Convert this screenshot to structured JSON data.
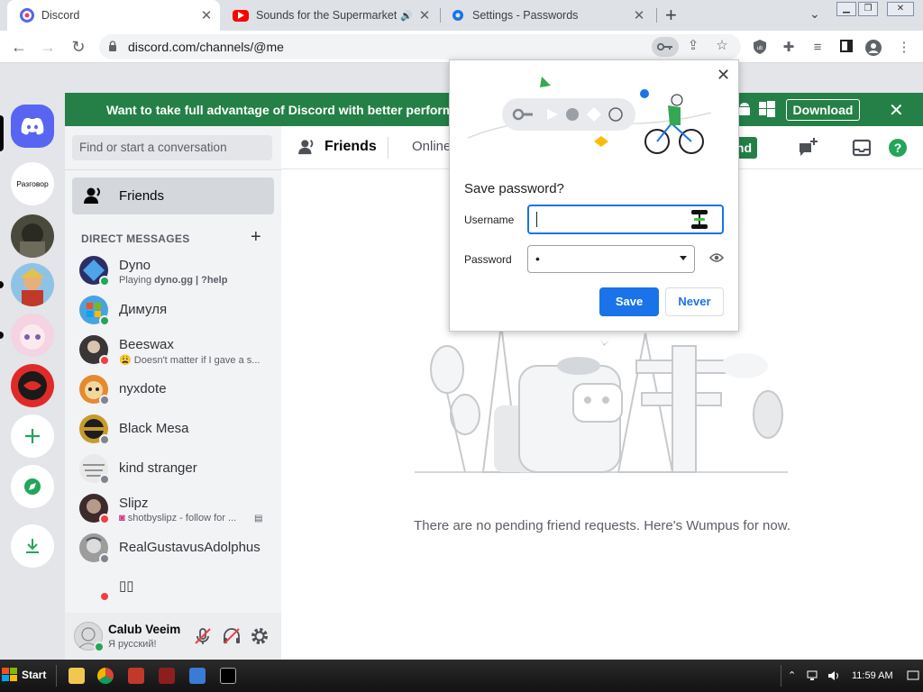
{
  "browser": {
    "tabs": [
      {
        "title": "Discord",
        "active": true
      },
      {
        "title": "Sounds for the Supermarket",
        "active": false
      },
      {
        "title": "Settings - Passwords",
        "active": false
      }
    ],
    "url": "discord.com/channels/@me"
  },
  "banner": {
    "message": "Want to take full advantage of Discord with better performance, i",
    "download_label": "Download"
  },
  "guilds": {
    "server_label": "Разговор"
  },
  "channels": {
    "search_placeholder": "Find or start a conversation",
    "friends_label": "Friends",
    "dm_header": "DIRECT MESSAGES",
    "dms": [
      {
        "name": "Dyno",
        "sub_prefix": "Playing ",
        "sub_bold": "dyno.gg | ?help",
        "status": "online",
        "color": "#2a2f66"
      },
      {
        "name": "Димуля",
        "status": "online",
        "color": "#4aa3df"
      },
      {
        "name": "Beeswax",
        "sub": "Doesn't matter if I gave a s...",
        "status": "dnd",
        "color": "#3a3536"
      },
      {
        "name": "nyxdote",
        "status": "offline",
        "color": "#e58a2e"
      },
      {
        "name": "Black Mesa",
        "status": "offline",
        "color": "#c89a2a"
      },
      {
        "name": "kind stranger",
        "status": "offline",
        "color": "#e9e9e9"
      },
      {
        "name": "Slipz",
        "sub": "shotbyslipz - follow for ...",
        "status": "dnd",
        "color": "#3d2b2b"
      },
      {
        "name": "RealGustavusAdolphus",
        "status": "offline",
        "color": "#9c9c9c"
      },
      {
        "name": "",
        "status": "dnd",
        "color": "#f2f3f5"
      }
    ]
  },
  "user": {
    "name": "Calub Veeim",
    "status_text": "Я русский!"
  },
  "main": {
    "title": "Friends",
    "online_tab": "Online",
    "add_friend_partial": "nd",
    "empty_message": "There are no pending friend requests. Here's Wumpus for now."
  },
  "password_popup": {
    "heading": "Save password?",
    "username_label": "Username",
    "username_value": "",
    "password_label": "Password",
    "password_value": "•",
    "save_label": "Save",
    "never_label": "Never"
  },
  "taskbar": {
    "start_label": "Start",
    "clock": "11:59 AM"
  },
  "colors": {
    "discord_green": "#248046",
    "chrome_blue": "#1a73e8",
    "blurple": "#5865f2",
    "online": "#23a55a",
    "dnd": "#f23f43",
    "offline": "#80848e"
  }
}
